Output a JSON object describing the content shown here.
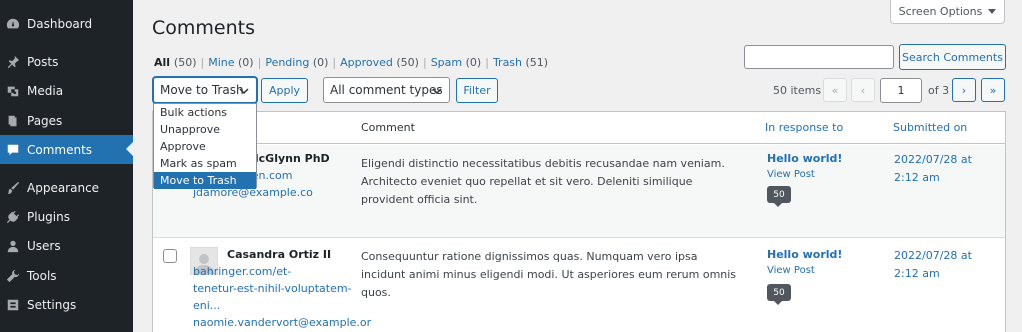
{
  "sidebar": {
    "items": [
      {
        "label": "Dashboard",
        "icon": "dashboard-icon"
      },
      {
        "label": "Posts",
        "icon": "pin-icon"
      },
      {
        "label": "Media",
        "icon": "media-icon"
      },
      {
        "label": "Pages",
        "icon": "pages-icon"
      },
      {
        "label": "Comments",
        "icon": "comment-icon",
        "current": true
      },
      {
        "label": "Appearance",
        "icon": "paintbrush-icon"
      },
      {
        "label": "Plugins",
        "icon": "plugin-icon"
      },
      {
        "label": "Users",
        "icon": "users-icon"
      },
      {
        "label": "Tools",
        "icon": "wrench-icon"
      },
      {
        "label": "Settings",
        "icon": "settings-icon"
      }
    ]
  },
  "header": {
    "title": "Comments",
    "screen_options": "Screen Options"
  },
  "filters": {
    "all": "All",
    "all_count": "(50)",
    "mine": "Mine",
    "mine_count": "(0)",
    "pending": "Pending",
    "pending_count": "(0)",
    "approved": "Approved",
    "approved_count": "(50)",
    "spam": "Spam",
    "spam_count": "(0)",
    "trash": "Trash",
    "trash_count": "(51)",
    "separator": "|"
  },
  "search": {
    "button_label": "Search Comments",
    "value": ""
  },
  "bulk": {
    "selected": "Move to Trash",
    "options": [
      "Bulk actions",
      "Unapprove",
      "Approve",
      "Mark as spam",
      "Move to Trash"
    ],
    "apply_label": "Apply",
    "type_selected": "All comment types",
    "filter_label": "Filter"
  },
  "pagination": {
    "items_text": "50 items",
    "first": "«",
    "prev": "‹",
    "current_page": "1",
    "of_text": "of 3",
    "next": "›",
    "last": "»"
  },
  "table": {
    "headers": {
      "comment": "Comment",
      "in_response_to": "In response to",
      "submitted_on": "Submitted on"
    },
    "rows": [
      {
        "author_name": "ae McGlynn PhD",
        "author_url": "eden.com",
        "author_email": "jdamore@example.co",
        "comment": "Eligendi distinctio necessitatibus debitis recusandae nam veniam. Architecto eveniet quo repellat et sit vero. Deleniti similique provident officia sint.",
        "response_title": "Hello world!",
        "view_post": "View Post",
        "count": "50",
        "date": "2022/07/28 at 2:12 am"
      },
      {
        "author_name": "Casandra Ortiz II",
        "author_url_1": "bahringer.com/et-",
        "author_url_2": "tenetur-est-nihil-voluptatem-",
        "author_url_3": "eni...",
        "author_email": "naomie.vandervort@example.or",
        "comment": "Consequuntur ratione dignissimos quas. Numquam vero ipsa incidunt animi minus eligendi modi. Ut asperiores eum rerum omnis quos.",
        "response_title": "Hello world!",
        "view_post": "View Post",
        "count": "50",
        "date": "2022/07/28 at 2:12 am"
      }
    ]
  },
  "colors": {
    "sidebar_bg": "#1d2327",
    "accent": "#2271b1",
    "page_bg": "#f0f0f1"
  }
}
